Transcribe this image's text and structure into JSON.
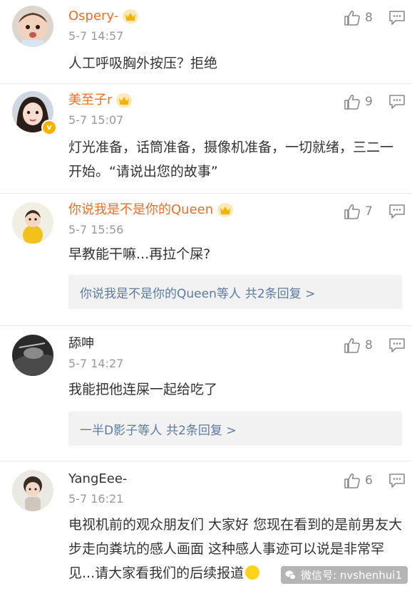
{
  "comments": [
    {
      "username": "Ospery-",
      "vip": true,
      "time": "5-7 14:57",
      "text": "人工呼吸胸外按压？拒绝",
      "likes": "8"
    },
    {
      "username": "美至子r",
      "vip": true,
      "verified": true,
      "time": "5-7 15:07",
      "text": "灯光准备，话筒准备，摄像机准备，一切就绪，三二一开始。“请说出您的故事”",
      "likes": "9"
    },
    {
      "username": "你说我是不是你的Queen",
      "vip": true,
      "time": "5-7 15:56",
      "text": "早教能干嘛...再拉个屎?",
      "likes": "7",
      "replies_from": "你说我是不是你的Queen等人",
      "replies_total": "共2条回复 >"
    },
    {
      "username": "舔呻",
      "vip": false,
      "time": "5-7 14:27",
      "text": "我能把他连屎一起给吃了",
      "likes": "8",
      "replies_from": "一半D影子等人",
      "replies_total": "共2条回复 >"
    },
    {
      "username": "YangEee-",
      "vip": false,
      "time": "5-7 16:21",
      "text": "电视机前的观众朋友们 大家好 您现在看到的是前男友大步走向粪坑的感人画面 这种感人事迹可以说是非常罕见...请大家看我们的后续报道",
      "likes": "6"
    }
  ],
  "watermark": "微信号: nvshenhui1",
  "colors": {
    "vip_name": "#f26d24",
    "plain_name": "#333333",
    "time": "#999999",
    "reply_link": "#5d7ba0",
    "reply_bg": "#f2f2f2",
    "crown": "#f5b200"
  },
  "icons": [
    "thumbs-up-icon",
    "comment-reply-icon",
    "vip-crown-icon",
    "verified-badge-icon",
    "wechat-icon",
    "smile-emoji-icon"
  ]
}
